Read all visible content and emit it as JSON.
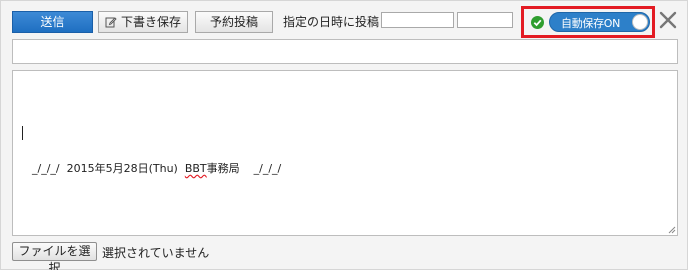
{
  "toolbar": {
    "send_label": "送信",
    "draft_label": "下書き保存",
    "draft_icon": "edit-icon",
    "reserve_label": "予約投稿",
    "schedule_label": "指定の日時に投稿",
    "schedule_date_value": "",
    "schedule_time_value": ""
  },
  "autosave": {
    "status_icon": "check-circle-icon",
    "toggle_label": "自動保存ON",
    "toggle_state": "on",
    "accent_color": "#2d80c9",
    "highlight_color": "#e31b23"
  },
  "close_icon": "close-icon",
  "title_field": {
    "value": ""
  },
  "body_field": {
    "signature": "_/_/_/  2015年5月28日(Thu)  BBT事務局    _/_/_/",
    "signature_parts": {
      "prefix": "_/_/_/  2015年5月28日(Thu)  ",
      "marked": "BBT",
      "suffix": "事務局    _/_/_/"
    }
  },
  "attachment": {
    "button_label": "ファイルを選択",
    "status_text": "選択されていません"
  }
}
